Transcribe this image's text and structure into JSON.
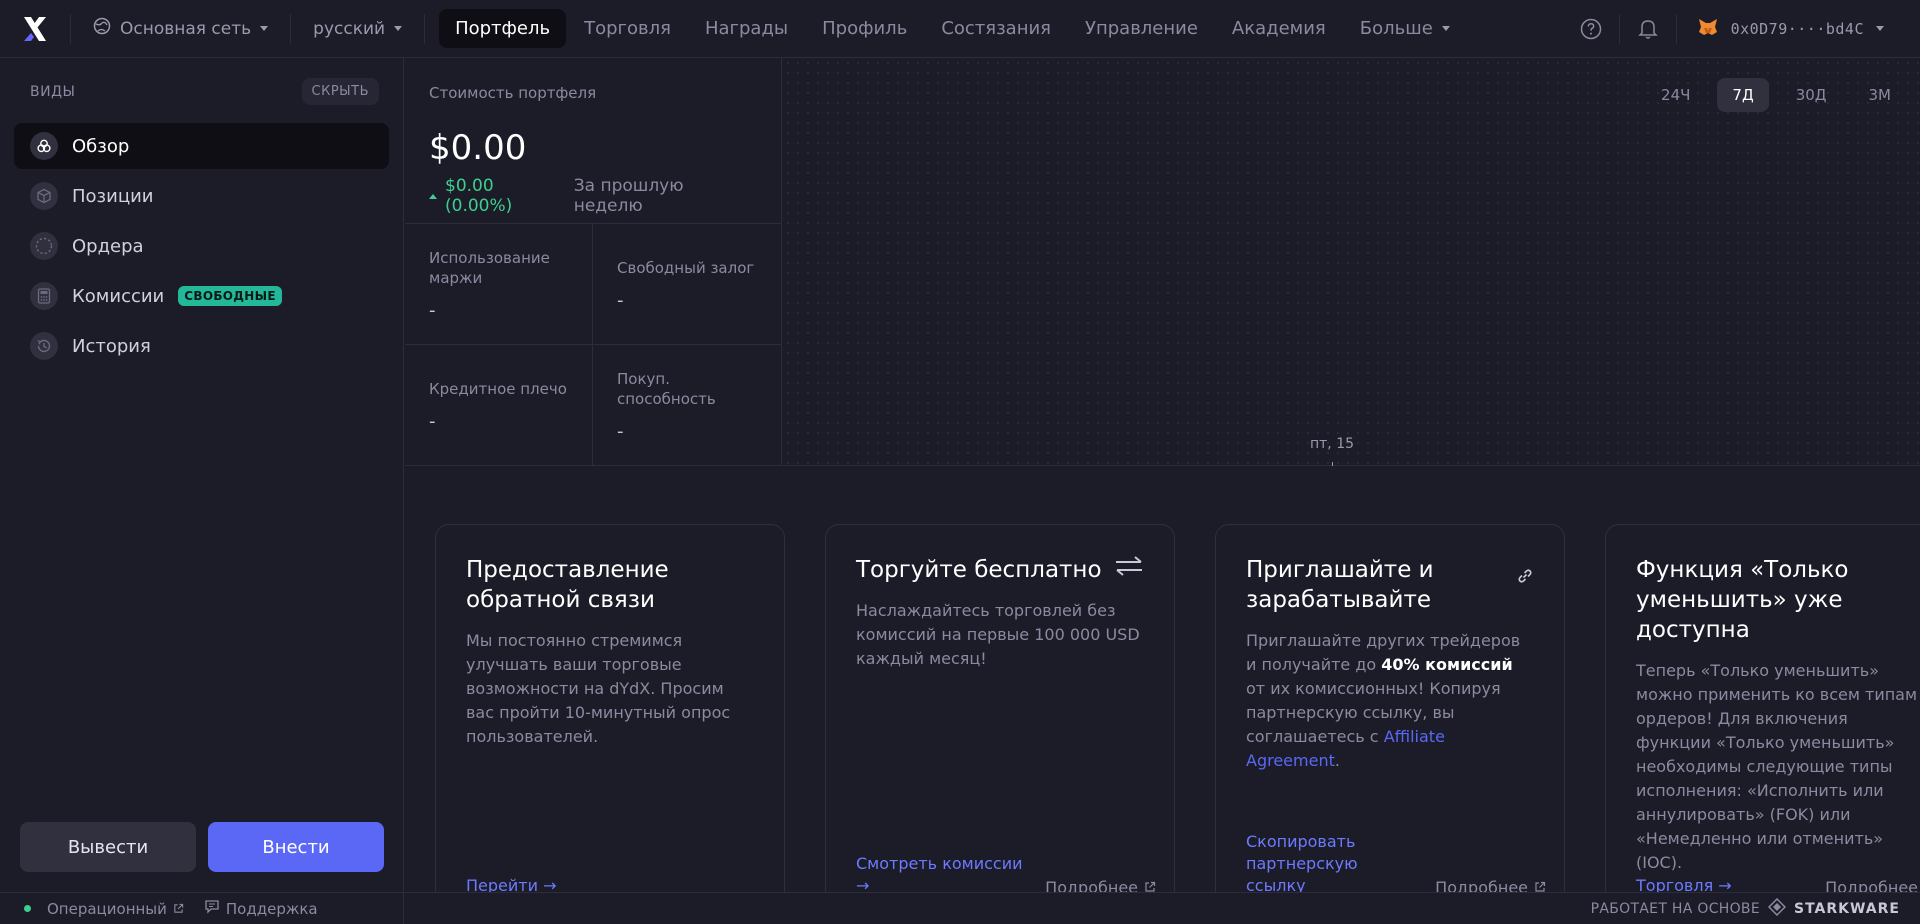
{
  "header": {
    "network": "Основная сеть",
    "language": "русский",
    "nav": [
      "Портфель",
      "Торговля",
      "Награды",
      "Профиль",
      "Состязания",
      "Управление",
      "Академия",
      "Больше"
    ],
    "wallet": "0x0D79····bd4C"
  },
  "sidebar": {
    "title": "ВИДЫ",
    "hide": "СКРЫТЬ",
    "items": [
      {
        "label": "Обзор"
      },
      {
        "label": "Позиции"
      },
      {
        "label": "Ордера"
      },
      {
        "label": "Комиссии",
        "badge": "СВОБОДНЫЕ"
      },
      {
        "label": "История"
      }
    ],
    "withdraw": "Вывести",
    "deposit": "Внести"
  },
  "portfolio": {
    "label": "Стоимость портфеля",
    "value": "$0.00",
    "change": "$0.00 (0.00%)",
    "change_period": "За прошлую неделю",
    "change_color": "#3dcf8e",
    "stats": [
      {
        "label": "Использование маржи",
        "value": "-"
      },
      {
        "label": "Свободный залог",
        "value": "-"
      },
      {
        "label": "Кредитное плечо",
        "value": "-"
      },
      {
        "label": "Покуп. способность",
        "value": "-"
      }
    ]
  },
  "chart": {
    "ranges": [
      "24Ч",
      "7Д",
      "30Д",
      "3М"
    ],
    "active_range": "7Д",
    "x_tick": "пт, 15"
  },
  "cards": [
    {
      "title": "Предоставление обратной связи",
      "body": "Мы постоянно стремимся улучшать ваши торговые возможности на dYdX. Просим вас пройти 10-минутный опрос пользователей.",
      "cta": "Перейти →"
    },
    {
      "title": "Торгуйте бесплатно",
      "body": "Наслаждайтесь торговлей без комиссий на первые 100 000 USD каждый месяц!",
      "cta": "Смотреть комиссии →",
      "more": "Подробнее"
    },
    {
      "title": "Приглашайте и зарабатывайте",
      "body_pre": "Приглашайте других трейдеров и получайте до",
      "body_bold": "40% комиссий",
      "body_mid": "от их комиссионных! Копируя партнерскую ссылку, вы соглашаетесь с",
      "body_link": "Affiliate Agreement",
      "body_end": ".",
      "cta": "Скопировать партнерскую ссылку",
      "more": "Подробнее"
    },
    {
      "title": "Функция «Только уменьшить» уже доступна",
      "body": "Теперь «Только уменьшить» можно применить ко всем типам ордеров! Для включения функции «Только уменьшить» необходимы следующие типы исполнения: «Исполнить или аннулировать» (FOK) или «Немедленно или отменить» (IOC).",
      "cta": "Торговля →",
      "more": "Подробнее"
    }
  ],
  "footer": {
    "status": "Операционный",
    "support": "Поддержка",
    "powered": "РАБОТАЕТ НА ОСНОВЕ",
    "brand": "STARKWARE"
  },
  "colors": {
    "accent": "#5a68f5",
    "positive": "#3dcf8e",
    "badge": "#23b89a"
  },
  "icons": [
    "dydx-logo-icon",
    "globe-icon",
    "help-icon",
    "bell-icon",
    "metamask-icon",
    "overview-icon",
    "cube-icon",
    "orders-icon",
    "calculator-icon",
    "history-icon",
    "swap-icon",
    "link-icon",
    "external-link-icon",
    "chat-icon"
  ]
}
